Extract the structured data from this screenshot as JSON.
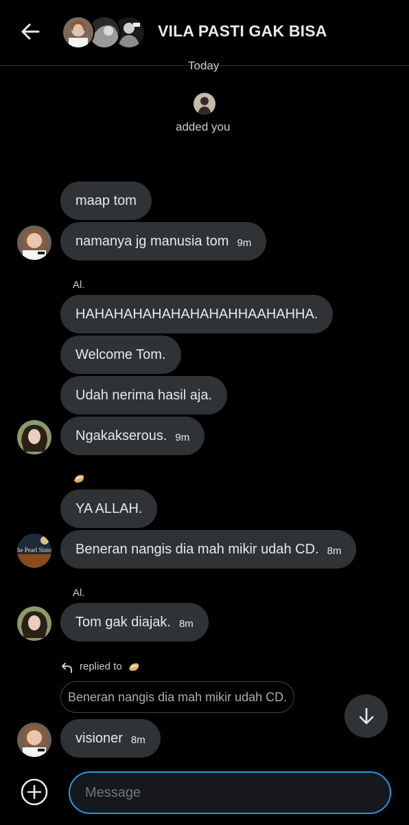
{
  "header": {
    "title": "VILA PASTI GAK BISA"
  },
  "system": {
    "date_label": "Today",
    "added_text": "added you"
  },
  "messages": [
    {
      "text": "maap tom",
      "time": ""
    },
    {
      "text": "namanya jg manusia tom",
      "time": "9m"
    },
    {
      "sender": "Al.",
      "text": "HAHAHAHAHAHAHAHAHHAAHAHHA.",
      "time": ""
    },
    {
      "text": "Welcome Tom.",
      "time": ""
    },
    {
      "text": "Udah nerima hasil aja.",
      "time": ""
    },
    {
      "text": "Ngakakserous.",
      "time": "9m"
    },
    {
      "text": "YA ALLAH.",
      "time": ""
    },
    {
      "text": "Beneran nangis dia mah mikir udah CD.",
      "time": "8m"
    },
    {
      "sender": "Al.",
      "text": "Tom gak diajak.",
      "time": "8m"
    },
    {
      "text": "visioner",
      "time": "8m"
    }
  ],
  "reply": {
    "label": "replied to",
    "quoted_text": "Beneran nangis dia mah mikir udah CD."
  },
  "avatar_text": {
    "book_cover": "The Pearl Sisters"
  },
  "composer": {
    "placeholder": "Message"
  },
  "colors": {
    "background": "#000000",
    "bubble": "#2f3336",
    "accent": "#1d9bf0",
    "text": "#e7e9ea"
  },
  "icons": [
    "back-arrow-icon",
    "arrow-down-icon",
    "plus-circle-icon",
    "reply-arrow-icon"
  ]
}
